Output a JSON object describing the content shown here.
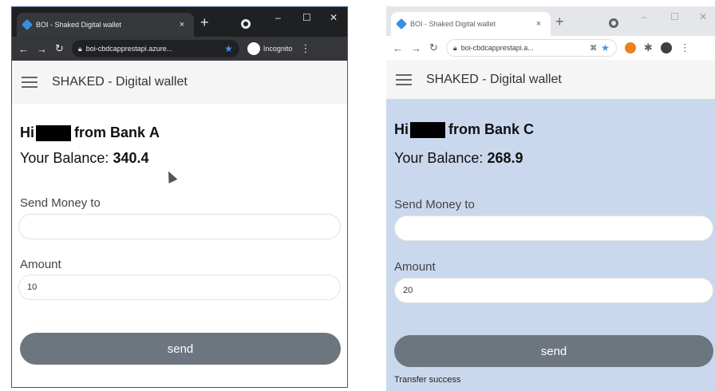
{
  "windowA": {
    "tab_title": "BOI - Shaked Digital wallet",
    "tab_close": "×",
    "new_tab": "+",
    "window_controls": [
      "–",
      "☐",
      "✕"
    ],
    "url": "boi-cbdcapprestapi.azure...",
    "incognito_label": "Incognito",
    "app_title": "SHAKED - Digital wallet",
    "greeting_prefix": "Hi",
    "greeting_mid": "from Bank",
    "bank": "A",
    "balance_label": "Your Balance:",
    "balance_value": "340.4",
    "send_to_label": "Send Money to",
    "send_to_value": "",
    "amount_label": "Amount",
    "amount_value": "10",
    "send_button": "send"
  },
  "windowC": {
    "tab_title": "BOI - Shaked Digital wallet",
    "tab_close": "×",
    "new_tab": "+",
    "window_controls": [
      "–",
      "☐",
      "✕"
    ],
    "url": "boi-cbdcapprestapi.a...",
    "app_title": "SHAKED - Digital wallet",
    "greeting_prefix": "Hi",
    "greeting_mid": "from Bank",
    "bank": "C",
    "balance_label": "Your Balance:",
    "balance_value": "268.9",
    "send_to_label": "Send Money to",
    "send_to_value": "",
    "amount_label": "Amount",
    "amount_value": "20",
    "send_button": "send",
    "status_message": "Transfer success"
  },
  "icons": [
    "back-icon",
    "forward-icon",
    "reload-icon",
    "lock-icon",
    "star-icon",
    "incognito-icon",
    "menu-icon",
    "extension-icon",
    "profile-icon"
  ],
  "colors": {
    "accent_button": "#6d757e",
    "content_bg_c": "#cad8ee",
    "incognito_dark": "#1f2022"
  }
}
